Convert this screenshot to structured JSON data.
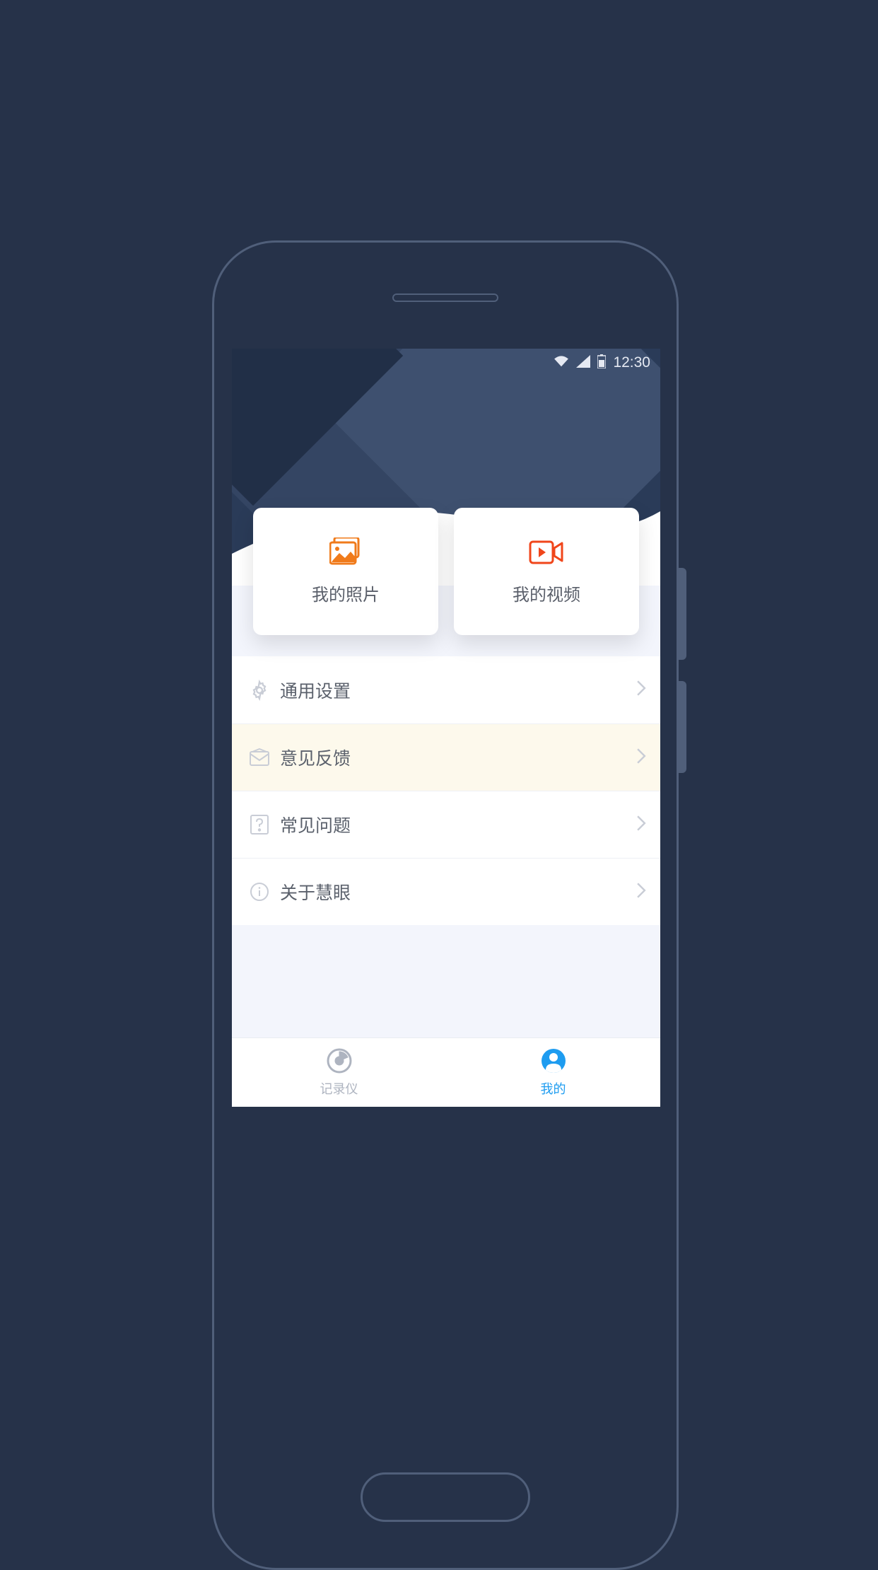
{
  "status_bar": {
    "time": "12:30"
  },
  "cards": {
    "photos": {
      "label": "我的照片"
    },
    "videos": {
      "label": "我的视频"
    }
  },
  "menu": {
    "settings": {
      "label": "通用设置"
    },
    "feedback": {
      "label": "意见反馈"
    },
    "faq": {
      "label": "常见问题"
    },
    "about": {
      "label": "关于慧眼"
    }
  },
  "tabs": {
    "recorder": {
      "label": "记录仪"
    },
    "mine": {
      "label": "我的"
    }
  }
}
